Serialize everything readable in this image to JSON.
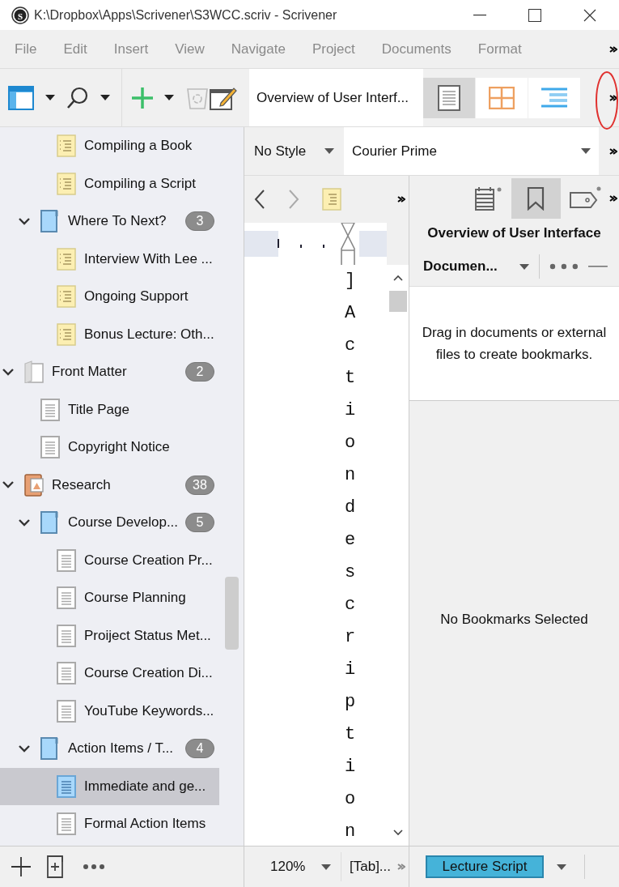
{
  "window": {
    "logo_letter": "S",
    "title": "K:\\Dropbox\\Apps\\Scrivener\\S3WCC.scriv - Scrivener"
  },
  "menu": [
    "File",
    "Edit",
    "Insert",
    "View",
    "Navigate",
    "Project",
    "Documents",
    "Format"
  ],
  "toolbar": {
    "document_title": "Overview of User Interf...",
    "view_modes": [
      {
        "kind": "document",
        "selected": true
      },
      {
        "kind": "corkboard",
        "selected": false
      },
      {
        "kind": "outline",
        "selected": false
      }
    ]
  },
  "binder": {
    "tree": [
      {
        "children": [
          {
            "children": [
              {
                "label": "Compiling a Book",
                "kind": "synopsis",
                "selected": false
              },
              {
                "label": "Compiling a Script",
                "kind": "synopsis",
                "selected": false
              }
            ]
          },
          {
            "label": "Where To Next?",
            "kind": "folder",
            "badge": "3",
            "expanded": true,
            "selected": false,
            "children": [
              {
                "label": "Interview With Lee ...",
                "kind": "synopsis",
                "selected": false
              },
              {
                "label": "Ongoing Support",
                "kind": "synopsis",
                "selected": false
              },
              {
                "label": "Bonus Lecture: Oth...",
                "kind": "synopsis",
                "selected": false
              }
            ]
          }
        ]
      },
      {
        "label": "Front Matter",
        "kind": "frontmatter",
        "badge": "2",
        "expanded": true,
        "selected": false,
        "children": [
          {
            "label": "Title Page",
            "kind": "page",
            "selected": false
          },
          {
            "label": "Copyright Notice",
            "kind": "page",
            "selected": false
          }
        ]
      },
      {
        "label": "Research",
        "kind": "research",
        "badge": "38",
        "expanded": true,
        "selected": false,
        "children": [
          {
            "label": "Course Develop...",
            "kind": "folder",
            "badge": "5",
            "expanded": true,
            "selected": false,
            "children": [
              {
                "label": "Course Creation Pr...",
                "kind": "page",
                "selected": false
              },
              {
                "label": "Course Planning",
                "kind": "page",
                "selected": false
              },
              {
                "label": "Proiject Status Met...",
                "kind": "page",
                "selected": false
              },
              {
                "label": "Course Creation Di...",
                "kind": "page",
                "selected": false
              },
              {
                "label": "YouTube Keywords...",
                "kind": "page",
                "selected": false
              }
            ]
          },
          {
            "label": "Action Items / T...",
            "kind": "folder",
            "badge": "4",
            "expanded": true,
            "selected": false,
            "children": [
              {
                "label": "Immediate and ge...",
                "kind": "page",
                "selected": true
              },
              {
                "label": "Formal Action Items",
                "kind": "page",
                "selected": false
              }
            ]
          }
        ]
      }
    ]
  },
  "format_bar": {
    "style": "No Style",
    "font": "Courier Prime"
  },
  "editor": {
    "text": "]Action description",
    "zoom": "120%",
    "tab_label": "[Tab]..."
  },
  "inspector": {
    "tabs": [
      {
        "kind": "notes",
        "selected": false
      },
      {
        "kind": "bookmarks",
        "selected": true
      },
      {
        "kind": "tags",
        "selected": false
      }
    ],
    "title": "Overview of User Interface",
    "list_selector": "Documen...",
    "hint": "Drag in documents or external files to create bookmarks.",
    "empty_text": "No Bookmarks Selected",
    "section_type": "Lecture Script"
  }
}
